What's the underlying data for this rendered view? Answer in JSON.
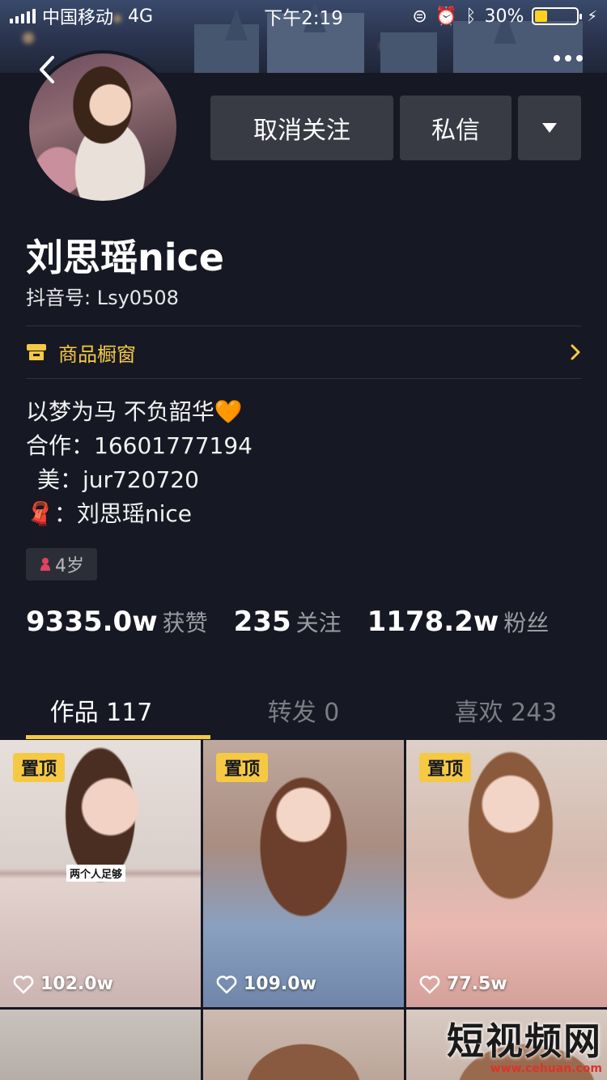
{
  "status_bar": {
    "carrier": "中国移动",
    "network": "4G",
    "time": "下午2:19",
    "battery": "30%",
    "battery_level": 0.3
  },
  "profile": {
    "nickname": "刘思瑶nice",
    "douyin_id": "抖音号: Lsy0508",
    "unfollow_label": "取消关注",
    "message_label": "私信",
    "shop_label": "商品橱窗",
    "bio": [
      {
        "prefix": "",
        "text": "以梦为马 不负韶华🧡"
      },
      {
        "prefix": "",
        "text": "合作：16601777194"
      },
      {
        "prefix": "",
        "text": "美：jur720720"
      },
      {
        "prefix": "🧣",
        "text": "：刘思瑶nice"
      }
    ],
    "age_tag": "4岁"
  },
  "stats": [
    {
      "value": "9335.0w",
      "label": "获赞"
    },
    {
      "value": "235",
      "label": "关注"
    },
    {
      "value": "1178.2w",
      "label": "粉丝"
    }
  ],
  "tabs": [
    {
      "label": "作品 117",
      "active": true
    },
    {
      "label": "转发 0",
      "active": false
    },
    {
      "label": "喜欢 243",
      "active": false
    }
  ],
  "videos": [
    {
      "pinned_label": "置顶",
      "likes": "102.0w",
      "caption": "两个人足够"
    },
    {
      "pinned_label": "置顶",
      "likes": "109.0w"
    },
    {
      "pinned_label": "置顶",
      "likes": "77.5w"
    }
  ],
  "watermark": {
    "title": "短视频网",
    "url": "www.cehuan.com"
  },
  "colors": {
    "background": "#161823",
    "accent": "#f6c945",
    "button": "#393b44"
  }
}
